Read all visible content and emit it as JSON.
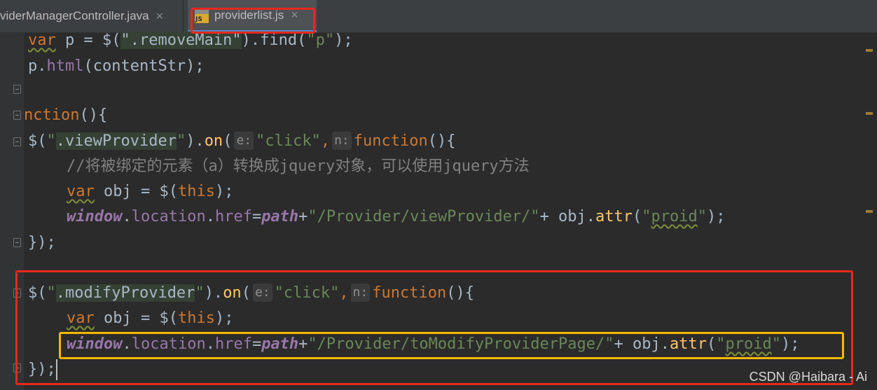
{
  "tabs": [
    {
      "label": "viderManagerController.java",
      "close": "×",
      "active": false
    },
    {
      "label": "providerlist.js",
      "close": "×",
      "active": true,
      "icon_text": "JS"
    }
  ],
  "code": {
    "l1": {
      "t1": "var",
      "t2": " p = $(",
      "t3": "\".removeMain\"",
      "t4": ").find(",
      "t5": "\"p\"",
      "t6": ");"
    },
    "l2": {
      "t1": "p.",
      "t2": "html",
      "t3": "(contentStr);"
    },
    "l3": {
      "t1": "nction",
      "t2": "(){"
    },
    "l4": {
      "t1": "$(",
      "t2": "\"",
      "t3": ".viewProvider",
      "t4": "\"",
      "t5": ").",
      "t6": "on",
      "t7": "(",
      "h1": "e:",
      "t8": "\"click\"",
      "t9": ",",
      "h2": "n:",
      "t10": "function",
      "t11": "(){"
    },
    "l5": {
      "t1": "//将被绑定的元素（a）转换成jquery对象，可以使用jquery方法"
    },
    "l6": {
      "t1": "var",
      "t2": " obj = $(",
      "t3": "this",
      "t4": ");"
    },
    "l7": {
      "t1": "window",
      "t2": ".",
      "t3": "location",
      "t4": ".",
      "t5": "href",
      "t6": "=",
      "t7": "path",
      "t8": "+",
      "t9": "\"/Provider/viewProvider/\"",
      "t10": "+ obj.",
      "t11": "attr",
      "t12": "(",
      "t13": "\"",
      "t14": "proid",
      "t15": "\"",
      "t16": ");"
    },
    "l8": {
      "t1": "});"
    },
    "l9": {
      "t1": "$(",
      "t2": "\"",
      "t3": ".modifyProvider",
      "t4": "\"",
      "t5": ").",
      "t6": "on",
      "t7": "(",
      "h1": "e:",
      "t8": "\"click\"",
      "t9": ",",
      "h2": "n:",
      "t10": "function",
      "t11": "(){"
    },
    "l10": {
      "t1": "var",
      "t2": " obj = $(",
      "t3": "this",
      "t4": ");"
    },
    "l11": {
      "t1": "window",
      "t2": ".",
      "t3": "location",
      "t4": ".",
      "t5": "href",
      "t6": "=",
      "t7": "path",
      "t8": "+",
      "t9": "\"/Provider/toModifyProviderPage/\"",
      "t10": "+ obj.",
      "t11": "attr",
      "t12": "(",
      "t13": "\"",
      "t14": "proid",
      "t15": "\"",
      "t16": ");"
    },
    "l12": {
      "t1": "});"
    }
  },
  "watermark": "CSDN @Haibara - Ai",
  "colors": {
    "background": "#2b2b2b",
    "keyword": "#cc7832",
    "function": "#ffc66d",
    "string": "#6a8759",
    "global": "#9876aa",
    "comment": "#808080",
    "highlight_red": "#e8281c",
    "highlight_orange": "#f5b800"
  }
}
